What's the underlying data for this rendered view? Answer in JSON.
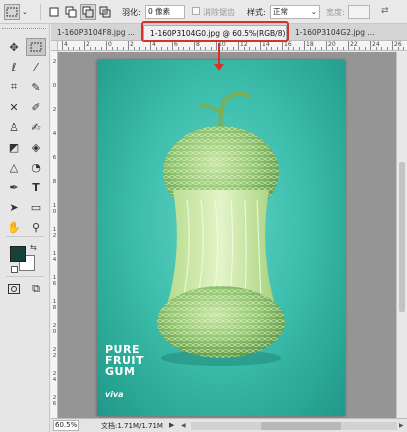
{
  "options_bar": {
    "feather_label": "羽化:",
    "feather_value": "0 像素",
    "antialias_label": "消除锯齿",
    "style_label": "样式:",
    "style_value": "正常",
    "width_label": "宽度:"
  },
  "tabs": [
    {
      "label": "1-160P3104F8.jpg ...",
      "active": false
    },
    {
      "label": "1-160P3104G0.jpg @ 60.5%(RGB/8)",
      "close": "×",
      "active": true
    },
    {
      "label": "1-160P3104G2.jpg ...",
      "active": false
    }
  ],
  "ruler": {
    "top": [
      "4",
      "2",
      "0",
      "2",
      "4",
      "6",
      "8",
      "10",
      "12",
      "14",
      "16",
      "18",
      "20",
      "22",
      "24",
      "26"
    ],
    "left": [
      "2",
      "0",
      "2",
      "4",
      "6",
      "8",
      "1\n0",
      "1\n2",
      "1\n4",
      "1\n6",
      "1\n8",
      "2\n0",
      "2\n2",
      "2\n4",
      "2\n6"
    ]
  },
  "artwork": {
    "brand_lines": [
      "PURE",
      "FRUIT",
      "GUM"
    ],
    "logo": "viva"
  },
  "status": {
    "zoom": "60.5%",
    "doc": "文档:1.71M/1.71M",
    "arrow": "▶",
    "scroll_left": "◀",
    "scroll_right": "▶"
  },
  "colors": {
    "annotation": "#d6312b",
    "foreground": "#17403b",
    "background": "#ffffff"
  }
}
